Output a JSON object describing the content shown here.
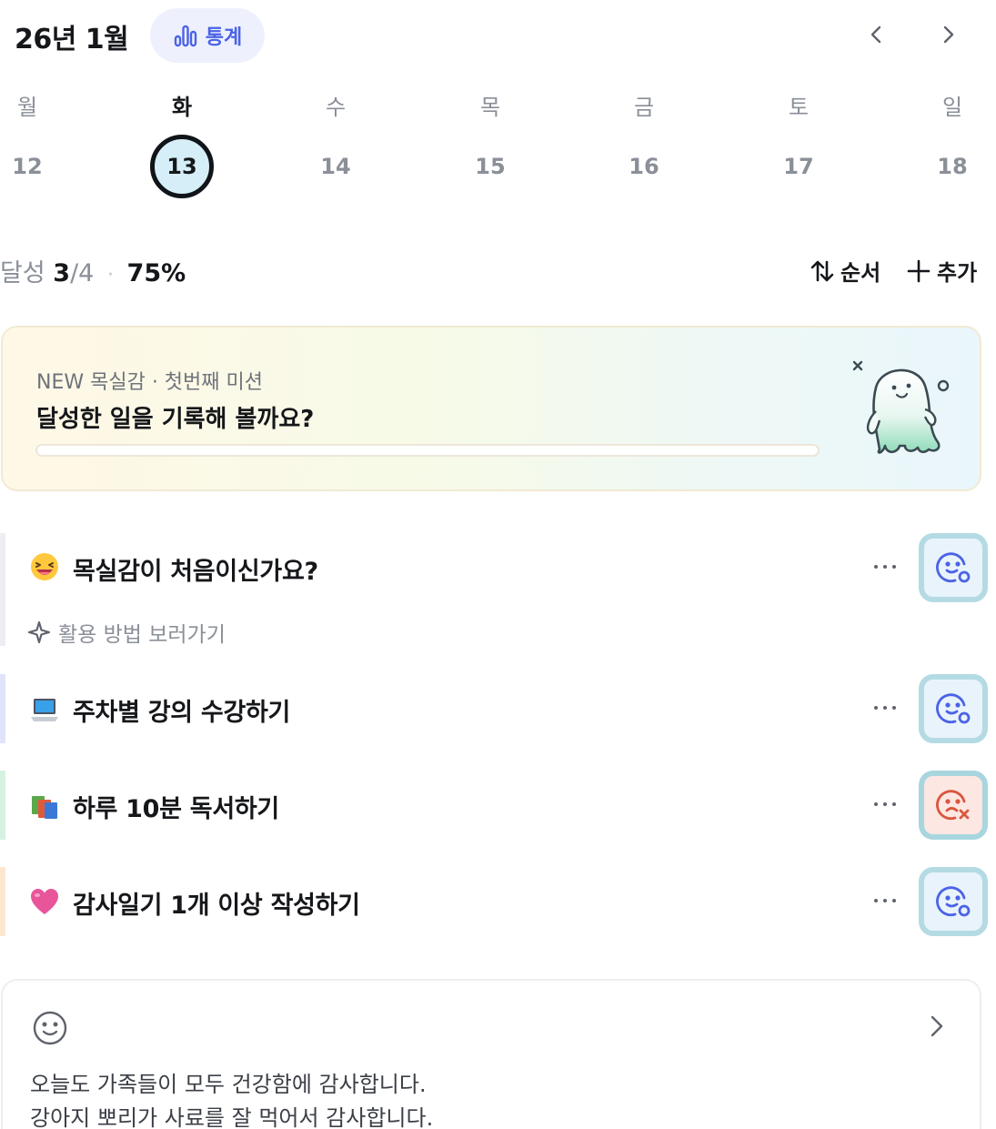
{
  "header": {
    "month": "26년 1월",
    "stats_label": "통계"
  },
  "week": {
    "days": [
      {
        "weekday": "월",
        "date": "12"
      },
      {
        "weekday": "화",
        "date": "13"
      },
      {
        "weekday": "수",
        "date": "14"
      },
      {
        "weekday": "목",
        "date": "15"
      },
      {
        "weekday": "금",
        "date": "16"
      },
      {
        "weekday": "토",
        "date": "17"
      },
      {
        "weekday": "일",
        "date": "18"
      }
    ],
    "selected_date": "13"
  },
  "summary": {
    "label": "달성",
    "done": "3",
    "total": "/4",
    "separator": "·",
    "percent": "75%",
    "sort_label": "순서",
    "add_label": "추가"
  },
  "banner": {
    "subtitle": "NEW 목실감 · 첫번째 미션",
    "title": "달성한 일을 기록해 볼까요?",
    "progress": 0
  },
  "habits": [
    {
      "title": "목실감이 처음이신가요?",
      "emoji": "laughing-face-emoji",
      "bar_color": "#eceef1",
      "status": "done",
      "link": "활용 방법 보러가기"
    },
    {
      "title": "주차별 강의 수강하기",
      "emoji": "laptop-emoji",
      "bar_color": "#dfe4fb",
      "status": "done"
    },
    {
      "title": "하루 10분 독서하기",
      "emoji": "books-emoji",
      "bar_color": "#d5f2e1",
      "status": "fail"
    },
    {
      "title": "감사일기 1개 이상 작성하기",
      "emoji": "pink-heart-emoji",
      "bar_color": "#fde8cf",
      "status": "done"
    }
  ],
  "journal": {
    "lines": [
      "오늘도 가족들이 모두 건강함에 감사합니다.",
      "강아지 뽀리가 사료를 잘 먹어서 감사합니다."
    ]
  },
  "colors": {
    "accent": "#4b63e6",
    "done_face": "#4b63e6",
    "fail_face": "#d9573f"
  }
}
